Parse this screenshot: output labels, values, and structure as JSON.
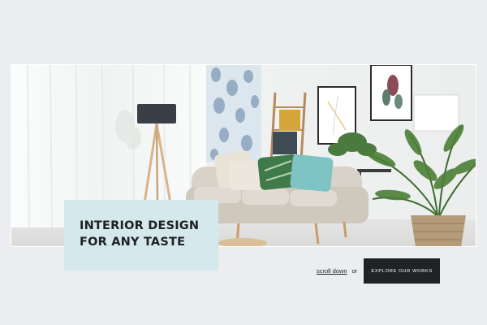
{
  "hero": {
    "image_alt": "Living room with sofa, cushions, floor lamp, framed art and potted palm",
    "title_lines": [
      "INTERIOR DESIGN",
      "FOR ANY TASTE"
    ]
  },
  "actions": {
    "scroll_label": "scroll down",
    "separator": "or",
    "explore_label": "EXPLORE OUR WORKS"
  },
  "colors": {
    "page_background": "#ebedf0",
    "title_card": "#d5e9ec",
    "button": "#212225",
    "text": "#1e1f22"
  }
}
